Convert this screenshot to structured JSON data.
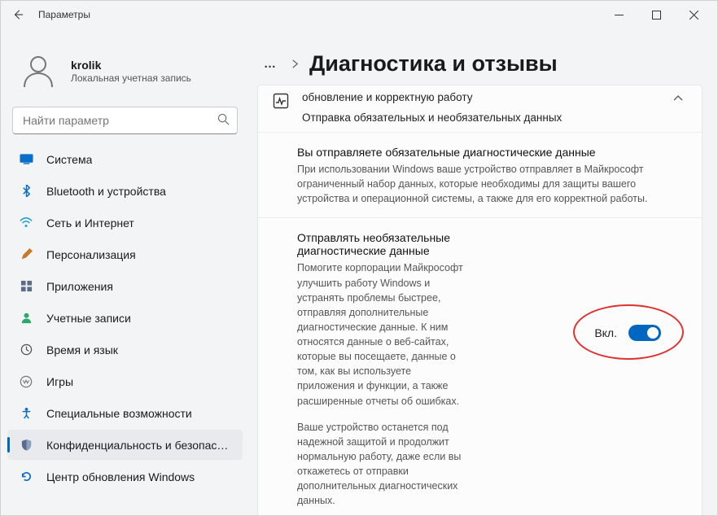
{
  "window": {
    "title": "Параметры"
  },
  "profile": {
    "name": "krolik",
    "subtitle": "Локальная учетная запись"
  },
  "search": {
    "placeholder": "Найти параметр"
  },
  "nav": [
    {
      "key": "system",
      "label": "Система"
    },
    {
      "key": "bluetooth",
      "label": "Bluetooth и устройства"
    },
    {
      "key": "network",
      "label": "Сеть и Интернет"
    },
    {
      "key": "personalization",
      "label": "Персонализация"
    },
    {
      "key": "apps",
      "label": "Приложения"
    },
    {
      "key": "accounts",
      "label": "Учетные записи"
    },
    {
      "key": "time",
      "label": "Время и язык"
    },
    {
      "key": "gaming",
      "label": "Игры"
    },
    {
      "key": "accessibility",
      "label": "Специальные возможности"
    },
    {
      "key": "privacy",
      "label": "Конфиденциальность и безопасность",
      "active": true
    },
    {
      "key": "update",
      "label": "Центр обновления Windows"
    }
  ],
  "colors": {
    "accent": "#0067c0",
    "highlight_oval": "#e03030"
  },
  "header": {
    "ellipsis": "…",
    "title": "Диагностика и отзывы"
  },
  "diag_card": {
    "top_line1": "обновление и корректную работу",
    "top_line2": "Отправка обязательных и необязательных данных",
    "required": {
      "title": "Вы отправляете обязательные диагностические данные",
      "desc": "При использовании Windows ваше устройство отправляет в Майкрософт ограниченный набор данных, которые необходимы для защиты вашего устройства и операционной системы, а также для его корректной работы."
    },
    "optional": {
      "title": "Отправлять необязательные диагностические данные",
      "desc1": "Помогите корпорации Майкрософт улучшить работу Windows и устранять проблемы быстрее, отправляя дополнительные диагностические данные. К ним относятся данные о веб-сайтах, которые вы посещаете, данные о том, как вы используете приложения и функции, а также расширенные отчеты об ошибках.",
      "desc2": "Ваше устройство останется под надежной защитой и продолжит нормальную работу, даже если вы откажетесь от отправки дополнительных диагностических данных.",
      "toggle_label": "Вкл.",
      "toggle_state": "on"
    }
  }
}
